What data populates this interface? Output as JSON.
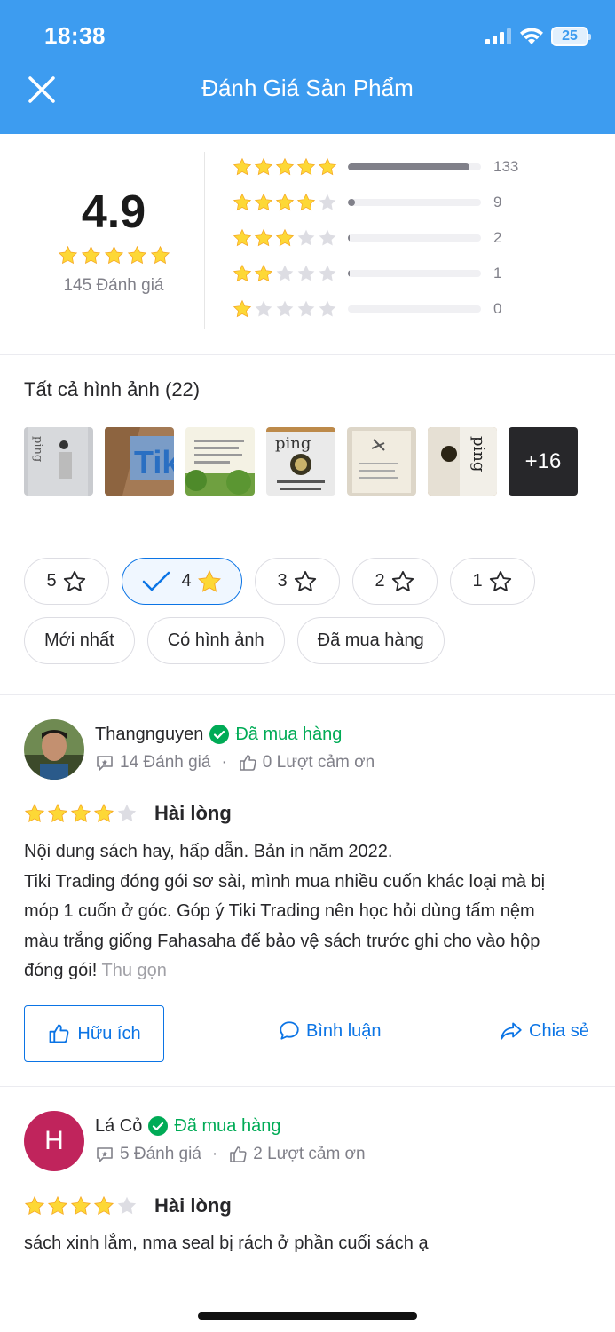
{
  "status_bar": {
    "time": "18:38",
    "battery": "25"
  },
  "header": {
    "title": "Đánh Giá Sản Phẩm",
    "close_icon": "close-icon"
  },
  "summary": {
    "average": "4.9",
    "average_stars": 5,
    "total_label": "145 Đánh giá",
    "rows": [
      {
        "stars": 5,
        "count": "133",
        "fraction": 0.91
      },
      {
        "stars": 4,
        "count": "9",
        "fraction": 0.06
      },
      {
        "stars": 3,
        "count": "2",
        "fraction": 0.013
      },
      {
        "stars": 2,
        "count": "1",
        "fraction": 0.007
      },
      {
        "stars": 1,
        "count": "0",
        "fraction": 0
      }
    ]
  },
  "images": {
    "title": "Tất cả hình ảnh (22)",
    "more_label": "+16"
  },
  "filters": {
    "stars": [
      {
        "label": "5",
        "selected": false
      },
      {
        "label": "4",
        "selected": true
      },
      {
        "label": "3",
        "selected": false
      },
      {
        "label": "2",
        "selected": false
      },
      {
        "label": "1",
        "selected": false
      }
    ],
    "sort": [
      "Mới nhất",
      "Có hình ảnh",
      "Đã mua hàng"
    ]
  },
  "reviews": [
    {
      "user": "Thangnguyen",
      "badge": "Đã mua hàng",
      "review_count": "14 Đánh giá",
      "thanks": "0 Lượt cảm ơn",
      "rating": 4,
      "rating_label": "Hài lòng",
      "text_lines": [
        "Nội dung sách hay, hấp dẫn. Bản in năm 2022.",
        "Tiki Trading đóng gói sơ sài, mình mua nhiều cuốn khác loại mà bị",
        "móp 1 cuốn ở góc. Góp ý Tiki Trading nên học hỏi dùng tấm nệm",
        "màu trắng giống Fahasaha để bảo vệ sách trước ghi cho vào hộp",
        "đóng gói!"
      ],
      "collapse_label": "Thu gọn",
      "useful_label": "Hữu ích",
      "comment_label": "Bình luận",
      "share_label": "Chia sẻ"
    },
    {
      "user": "Lá Cỏ",
      "avatar_letter": "H",
      "badge": "Đã mua hàng",
      "review_count": "5 Đánh giá",
      "thanks": "2 Lượt cảm ơn",
      "rating": 4,
      "rating_label": "Hài lòng",
      "text": "sách xinh lắm, nma seal bị rách ở phần cuối sách ạ"
    }
  ],
  "colors": {
    "header": "#3d9cf0",
    "accent": "#0b74e5",
    "star": "#fdd836",
    "verified": "#00ab56"
  }
}
